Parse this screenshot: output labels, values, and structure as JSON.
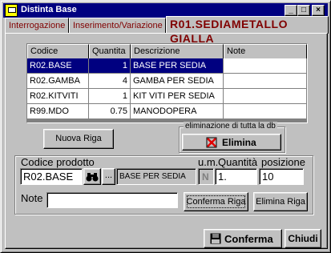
{
  "window": {
    "title": "Distinta Base",
    "controls": {
      "minimize": "_",
      "maximize": "□",
      "close": "×"
    }
  },
  "tabs": [
    {
      "label": "Interrogazione"
    },
    {
      "label": "Inserimento/Variazione"
    },
    {
      "label": "R01.SEDIAMETALLO GIALLA"
    }
  ],
  "grid": {
    "columns": [
      "Codice",
      "Quantita",
      "Descrizione",
      "Note"
    ],
    "rows": [
      {
        "codice": "R02.BASE",
        "quantita": "1",
        "descrizione": "BASE PER SEDIA",
        "note": ""
      },
      {
        "codice": "R02.GAMBA",
        "quantita": "4",
        "descrizione": "GAMBA PER SEDIA",
        "note": ""
      },
      {
        "codice": "R02.KITVITI",
        "quantita": "1",
        "descrizione": "KIT VITI PER SEDIA",
        "note": ""
      },
      {
        "codice": "R99.MDO",
        "quantita": "0.75",
        "descrizione": "MANODOPERA",
        "note": ""
      }
    ]
  },
  "actions": {
    "nuova_riga": "Nuova Riga",
    "elimina_group_caption": "eliminazione di tutta la db",
    "elimina": "Elimina"
  },
  "editor": {
    "codice_label": "Codice prodotto",
    "codice_value": "R02.BASE",
    "binoculars_icon": "binoculars-icon",
    "ellipsis": "...",
    "descrizione_value": "BASE PER SEDIA",
    "um_label": "u.m.",
    "um_value": "N",
    "quantita_label": "Quantità",
    "quantita_value": "1.",
    "posizione_label": "posizione",
    "posizione_value": "10",
    "note_label": "Note",
    "note_value": "",
    "conferma_riga": "Conferma Riga",
    "elimina_riga": "Elimina Riga"
  },
  "footer": {
    "conferma": "Conferma",
    "chiudi": "Chiudi"
  },
  "colors": {
    "titlebar": "#000080",
    "selection": "#000080",
    "tab_text": "#800000",
    "face": "#c0c0c0"
  }
}
